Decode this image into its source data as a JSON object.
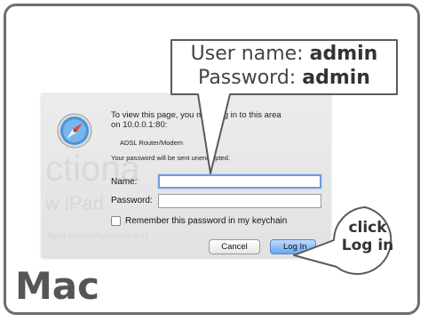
{
  "callout": {
    "username_label": "User name: ",
    "username_value": "admin",
    "password_label": "Password:  ",
    "password_value": "admin"
  },
  "dialog": {
    "message_line1": "To view this page, you must log in to this area",
    "message_line2": "on 10.0.0.1:80:",
    "realm": "ADSL Router/Modem",
    "unencrypted_notice": "Your password will be sent unencrypted.",
    "name_label": "Name:",
    "name_value": "",
    "password_label": "Password:",
    "password_value": "",
    "remember_label": "Remember this password in my keychain",
    "cancel_label": "Cancel",
    "login_label": "Log In",
    "background_watermark": {
      "line1": "ctiona",
      "line2": "w iPad",
      "line3": "Right-related  Reference  8/11"
    }
  },
  "click_hint": {
    "line1": "click",
    "line2": "Log in"
  },
  "platform_label": "Mac",
  "colors": {
    "frame_border": "#6e6e6e",
    "focus_ring": "#6f9de0",
    "default_button": "#6aa7f0"
  },
  "icons": {
    "app": "safari-compass-icon"
  }
}
